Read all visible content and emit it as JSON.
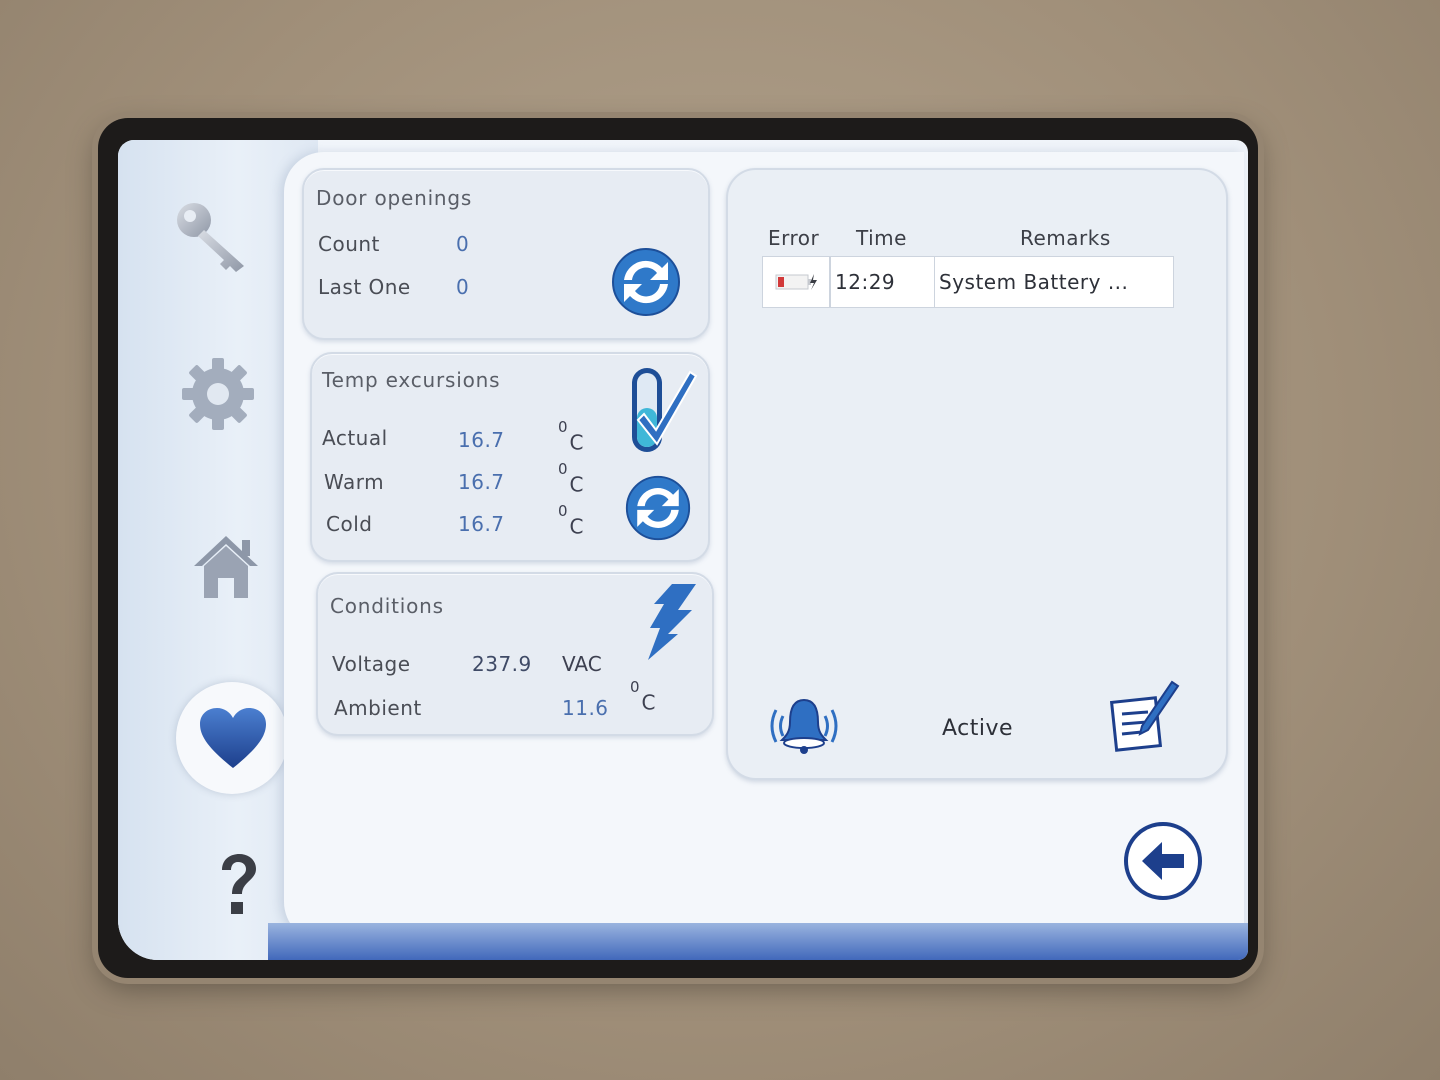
{
  "door": {
    "title": "Door openings",
    "count_label": "Count",
    "count_value": "0",
    "last_label": "Last One",
    "last_value": "0"
  },
  "temp": {
    "title": "Temp excursions",
    "actual_label": "Actual",
    "actual_value": "16.7",
    "warm_label": "Warm",
    "warm_value": "16.7",
    "cold_label": "Cold",
    "cold_value": "16.7",
    "unit_sup": "0",
    "unit": "C"
  },
  "conditions": {
    "title": "Conditions",
    "voltage_label": "Voltage",
    "voltage_value": "237.9",
    "voltage_unit": "VAC",
    "ambient_label": "Ambient",
    "ambient_value": "11.6",
    "unit_sup": "0",
    "unit": "C"
  },
  "log": {
    "headers": {
      "error": "Error",
      "time": "Time",
      "remarks": "Remarks"
    },
    "rows": [
      {
        "time": "12:29",
        "remarks": "System Battery ..."
      }
    ],
    "status": "Active"
  },
  "icons": {
    "key": "key-icon",
    "gear": "gear-icon",
    "home": "home-icon",
    "heart": "heart-icon",
    "help": "question-icon",
    "refresh": "refresh-icon",
    "thermometer_check": "thermometer-check-icon",
    "lightning": "lightning-icon",
    "bell": "bell-icon",
    "notes": "notes-icon",
    "back": "back-arrow-icon",
    "battery": "battery-icon"
  },
  "colors": {
    "accent": "#2f6fc2",
    "text": "#4a4d55",
    "value": "#4a6fae",
    "panel": "#e7ecf3"
  }
}
